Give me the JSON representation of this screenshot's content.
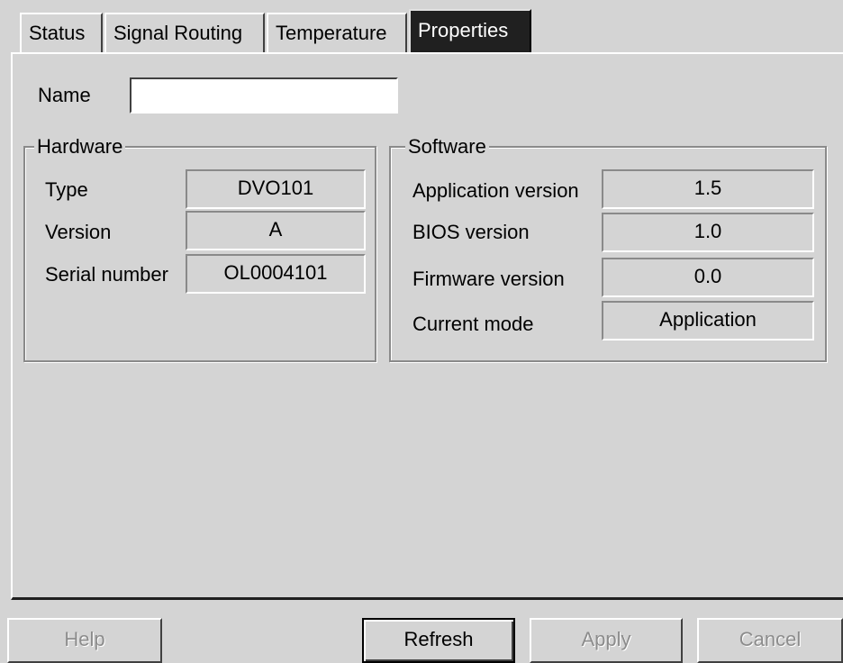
{
  "tabs": [
    {
      "label": "Status",
      "active": false
    },
    {
      "label": "Signal Routing",
      "active": false
    },
    {
      "label": "Temperature",
      "active": false
    },
    {
      "label": "Properties",
      "active": true
    }
  ],
  "name": {
    "label": "Name",
    "value": ""
  },
  "hardware": {
    "title": "Hardware",
    "type_label": "Type",
    "type_value": "DVO101",
    "version_label": "Version",
    "version_value": "A",
    "serial_label": "Serial number",
    "serial_value": "OL0004101"
  },
  "software": {
    "title": "Software",
    "app_label": "Application version",
    "app_value": "1.5",
    "bios_label": "BIOS version",
    "bios_value": "1.0",
    "firmware_label": "Firmware version",
    "firmware_value": "0.0",
    "mode_label": "Current mode",
    "mode_value": "Application"
  },
  "buttons": {
    "help": "Help",
    "refresh": "Refresh",
    "apply": "Apply",
    "cancel": "Cancel"
  },
  "colors": {
    "background": "#d4d4d4",
    "active_tab": "#202020",
    "disabled_text": "#8c8c8c"
  }
}
